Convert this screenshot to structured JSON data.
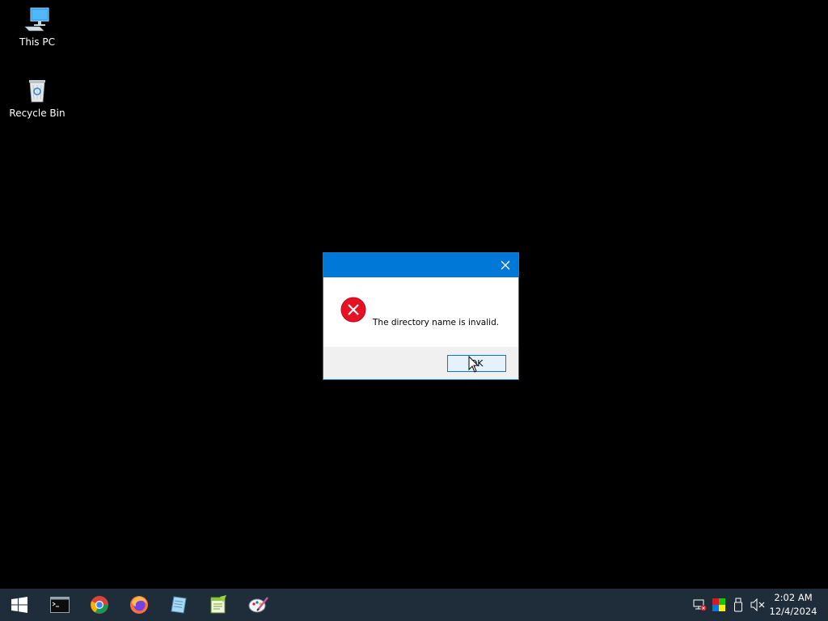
{
  "desktop": {
    "background": "#000000",
    "icons": [
      {
        "label": "This PC",
        "icon": "this-pc-icon"
      },
      {
        "label": "Recycle Bin",
        "icon": "recycle-bin-icon"
      }
    ]
  },
  "dialog": {
    "title": "",
    "close_icon": "close-icon",
    "message_icon": "error-icon",
    "message": "The directory name is invalid.",
    "ok_label": "OK",
    "titlebar_color": "#0078d7"
  },
  "taskbar": {
    "background": "#1f2c3a",
    "start_icon": "windows-logo-icon",
    "pinned": [
      {
        "name": "Command Prompt",
        "icon": "cmd-icon"
      },
      {
        "name": "Google Chrome",
        "icon": "chrome-icon"
      },
      {
        "name": "Firefox",
        "icon": "firefox-icon"
      },
      {
        "name": "Notepad",
        "icon": "notepad-icon"
      },
      {
        "name": "Notepad++",
        "icon": "notepadpp-icon"
      },
      {
        "name": "Paint",
        "icon": "paint-icon"
      }
    ],
    "tray": [
      {
        "icon": "network-icon"
      },
      {
        "icon": "color-icon"
      },
      {
        "icon": "usb-icon"
      },
      {
        "icon": "volume-muted-icon"
      }
    ],
    "clock": {
      "time": "2:02 AM",
      "date": "12/4/2024"
    }
  }
}
